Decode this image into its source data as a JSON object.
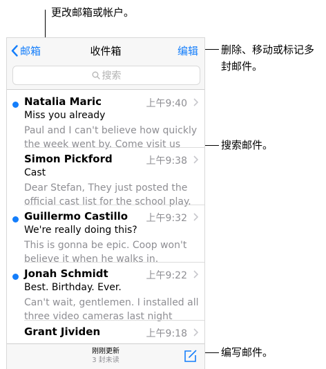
{
  "callouts": {
    "top": "更改邮箱或帐户。",
    "right_top_line1": "删除、移动或标记多",
    "right_top_line2": "封邮件。",
    "search": "搜索邮件。",
    "compose": "编写邮件。"
  },
  "nav": {
    "back_label": "邮箱",
    "title": "收件箱",
    "edit_label": "编辑"
  },
  "search": {
    "placeholder": "搜索"
  },
  "messages": [
    {
      "sender": "Natalia Maric",
      "time": "上午9:40",
      "unread": true,
      "subject": "Miss you already",
      "preview": "Paul and I can't believe how quickly the week went by. Come visit us again so…"
    },
    {
      "sender": "Simon Pickford",
      "time": "上午9:38",
      "unread": false,
      "subject": "Cast",
      "preview": "Dear Stefan, They just posted the official cast list for the school play. Congrat…"
    },
    {
      "sender": "Guillermo Castillo",
      "time": "上午9:32",
      "unread": true,
      "subject": "We're really doing this?",
      "preview": "This is gonna be epic. Coop won't believe it when he walks in. Everyone…"
    },
    {
      "sender": "Jonah Schmidt",
      "time": "上午9:22",
      "unread": true,
      "subject": "Best. Birthday. Ever.",
      "preview": "Can't wait, gentlemen. I installed all three video cameras last night and…"
    },
    {
      "sender": "Grant Jividen",
      "time": "上午9:18",
      "unread": false,
      "subject": "",
      "preview": ""
    }
  ],
  "toolbar": {
    "updated": "刚刚更新",
    "unread_count": "3 封未读"
  },
  "colors": {
    "accent": "#147efb",
    "secondary_text": "#8e8e93"
  },
  "icons": {
    "back": "chevron-left-icon",
    "search": "magnifier-icon",
    "disclosure": "chevron-right-icon",
    "compose": "compose-icon"
  }
}
